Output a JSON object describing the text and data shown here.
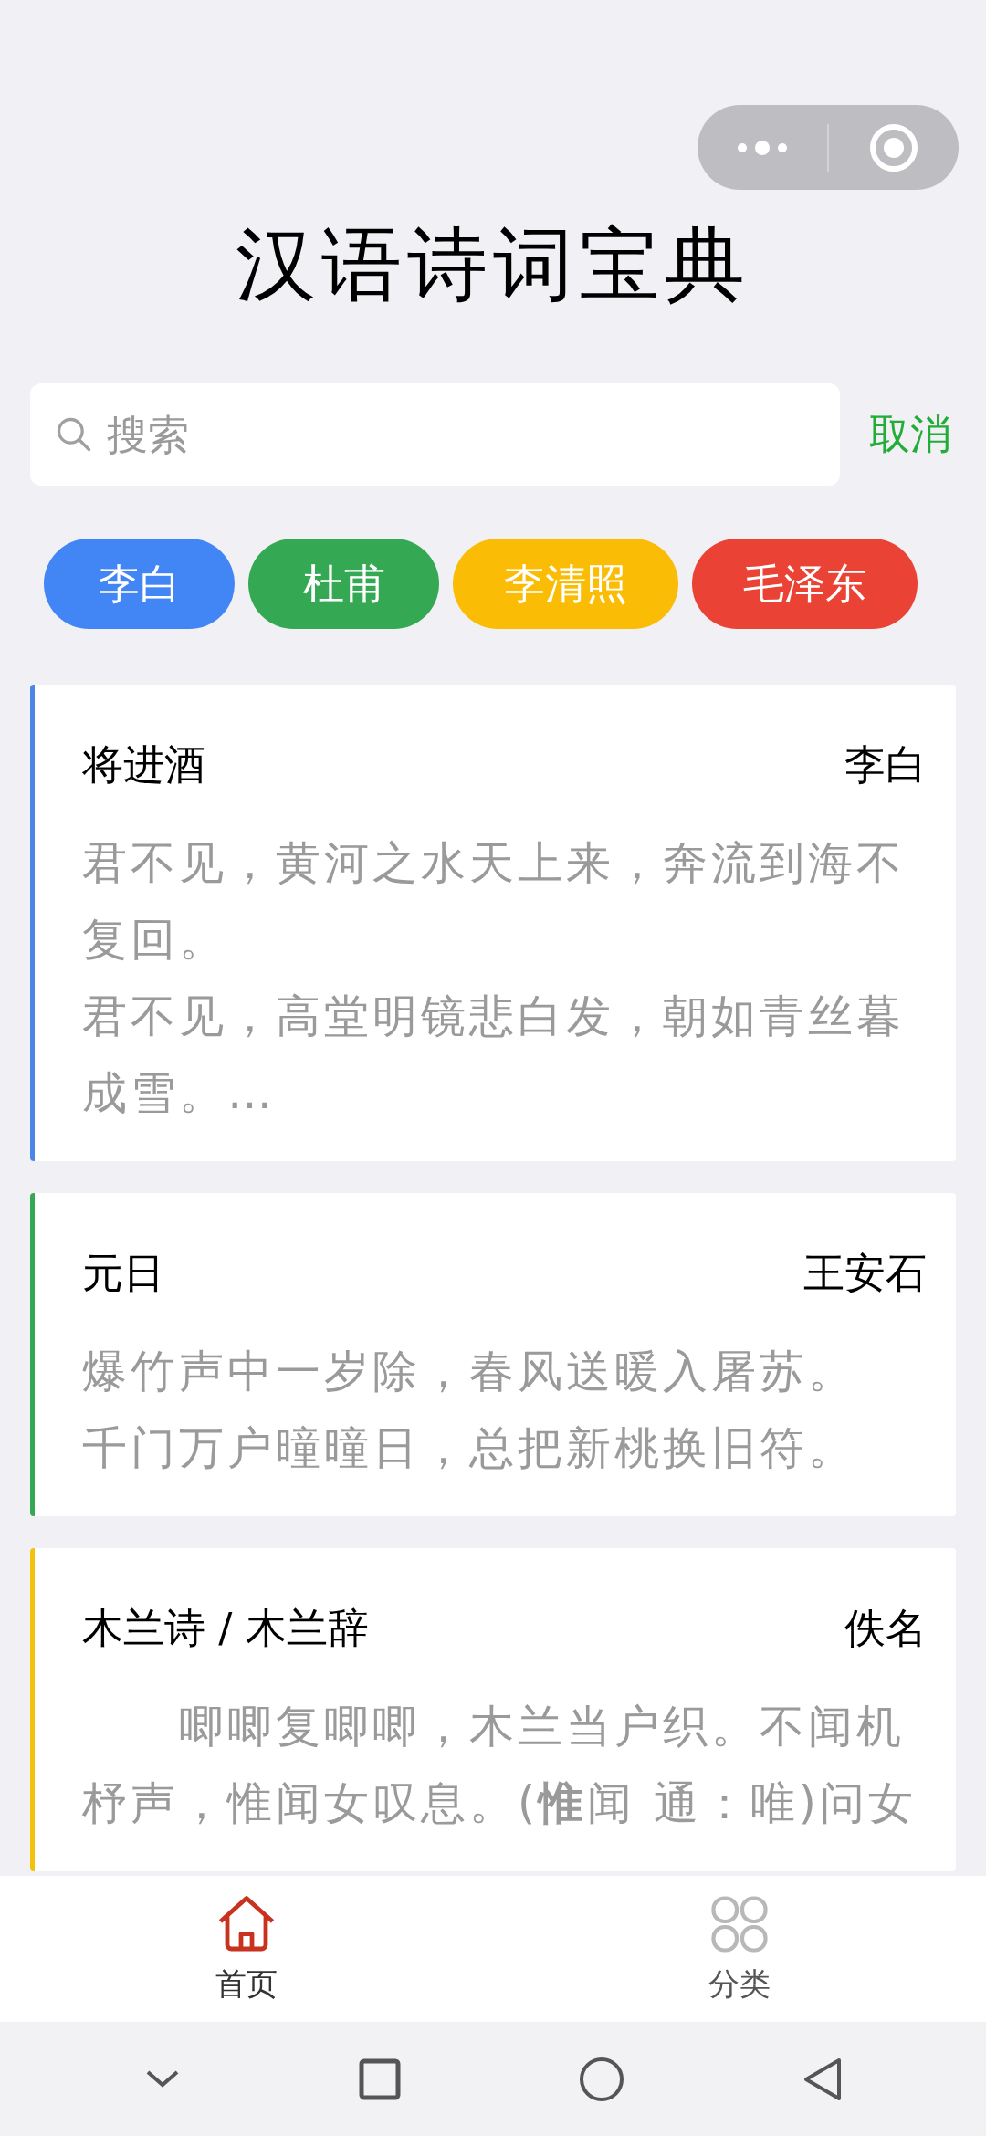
{
  "title": "汉语诗词宝典",
  "search": {
    "placeholder": "搜索",
    "cancel": "取消"
  },
  "tags": [
    {
      "label": "李白",
      "color": "#4285f4"
    },
    {
      "label": "杜甫",
      "color": "#34a853"
    },
    {
      "label": "李清照",
      "color": "#fbbc05"
    },
    {
      "label": "毛泽东",
      "color": "#ea4335"
    }
  ],
  "poems": [
    {
      "title": "将进酒",
      "author": "李白",
      "color": "#4a86e8",
      "paragraphs": [
        "君不见，黄河之水天上来，奔流到海不复回。",
        "君不见，高堂明镜悲白发，朝如青丝暮成雪。…"
      ]
    },
    {
      "title": "元日",
      "author": "王安石",
      "color": "#34a853",
      "paragraphs": [
        "爆竹声中一岁除，春风送暖入屠苏。",
        "千门万户曈曈日，总把新桃换旧符。"
      ]
    },
    {
      "title": "木兰诗 / 木兰辞",
      "author": "佚名",
      "color": "#f4c20d",
      "paragraphs": [
        "　　唧唧复唧唧，木兰当户织。不闻机杼声，惟闻女叹息。(**惟**闻 通：唯)问女"
      ]
    }
  ],
  "tabbar": [
    {
      "label": "首页",
      "kind": "home",
      "selected": true
    },
    {
      "label": "分类",
      "kind": "category",
      "selected": false
    }
  ]
}
